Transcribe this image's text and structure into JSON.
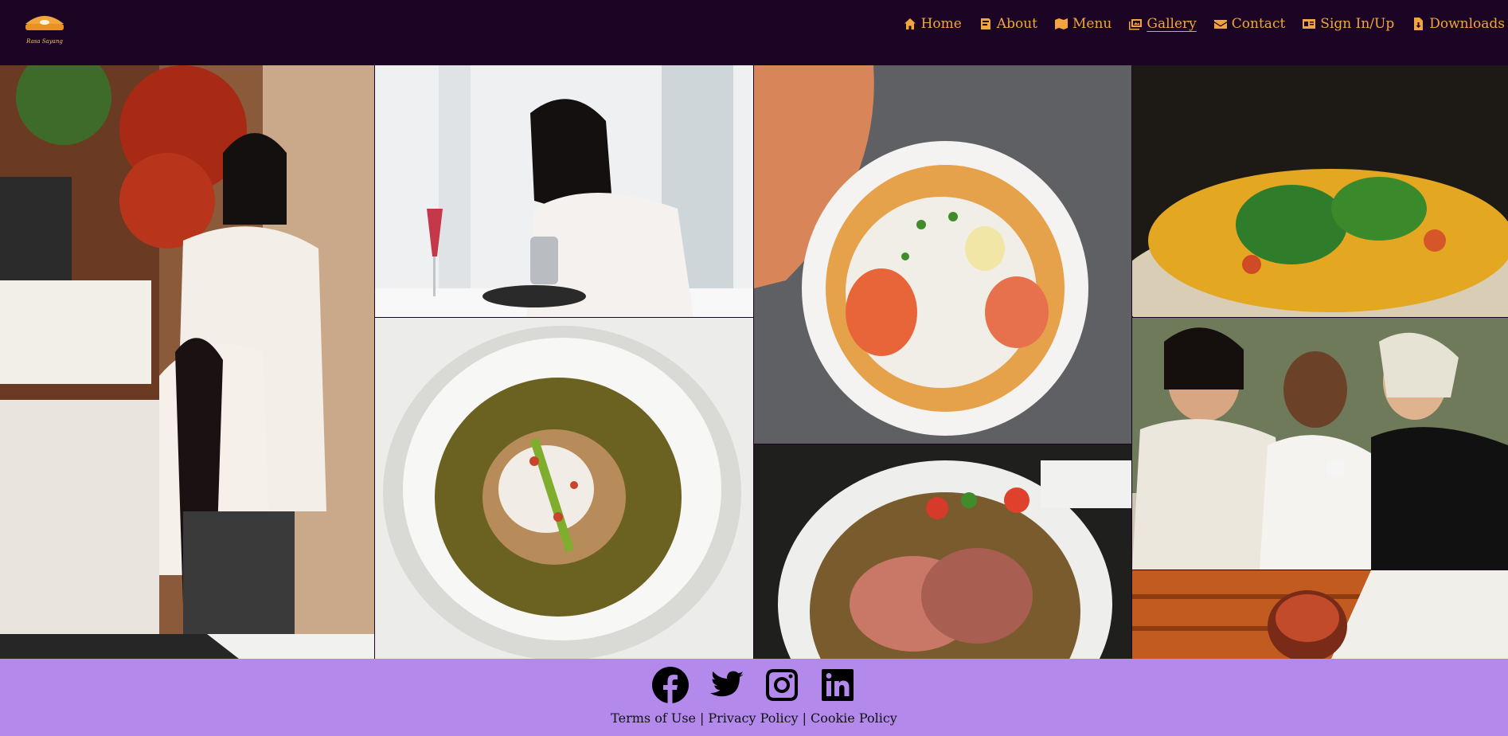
{
  "brand": {
    "logo_text": "Rasa Sayang"
  },
  "nav": {
    "items": [
      {
        "id": "home",
        "label": "Home",
        "icon": "home-icon"
      },
      {
        "id": "about",
        "label": "About",
        "icon": "book-icon"
      },
      {
        "id": "menu",
        "label": "Menu",
        "icon": "map-icon"
      },
      {
        "id": "gallery",
        "label": "Gallery",
        "icon": "images-icon",
        "active": true
      },
      {
        "id": "contact",
        "label": "Contact",
        "icon": "envelope-icon"
      },
      {
        "id": "signin",
        "label": "Sign In/Up",
        "icon": "id-card-icon"
      },
      {
        "id": "downloads",
        "label": "Downloads",
        "icon": "file-download-icon"
      }
    ]
  },
  "gallery": {
    "images": [
      {
        "id": "mother-daughter-register",
        "icon": "photo-icon"
      },
      {
        "id": "woman-eating-phone",
        "icon": "photo-icon"
      },
      {
        "id": "noodle-soup-bowl",
        "icon": "photo-icon"
      },
      {
        "id": "shrimp-noodle-soup",
        "icon": "photo-icon"
      },
      {
        "id": "steak-salad",
        "icon": "photo-icon"
      },
      {
        "id": "yellow-noodles-veg",
        "icon": "photo-icon"
      },
      {
        "id": "friends-cafe-phone",
        "icon": "photo-icon"
      },
      {
        "id": "menu-table-drink",
        "icon": "photo-icon"
      },
      {
        "id": "partial-bottom-left",
        "icon": "photo-icon"
      }
    ]
  },
  "footer": {
    "socials": [
      {
        "id": "facebook",
        "icon": "facebook-icon"
      },
      {
        "id": "twitter",
        "icon": "twitter-icon"
      },
      {
        "id": "instagram",
        "icon": "instagram-icon"
      },
      {
        "id": "linkedin",
        "icon": "linkedin-icon"
      }
    ],
    "terms": "Terms of Use",
    "privacy": "Privacy Policy",
    "cookie": "Cookie Policy",
    "separator": "|"
  },
  "colors": {
    "header_bg": "#1c0524",
    "nav_text": "#f0a53e",
    "footer_bg": "#b389ec"
  }
}
